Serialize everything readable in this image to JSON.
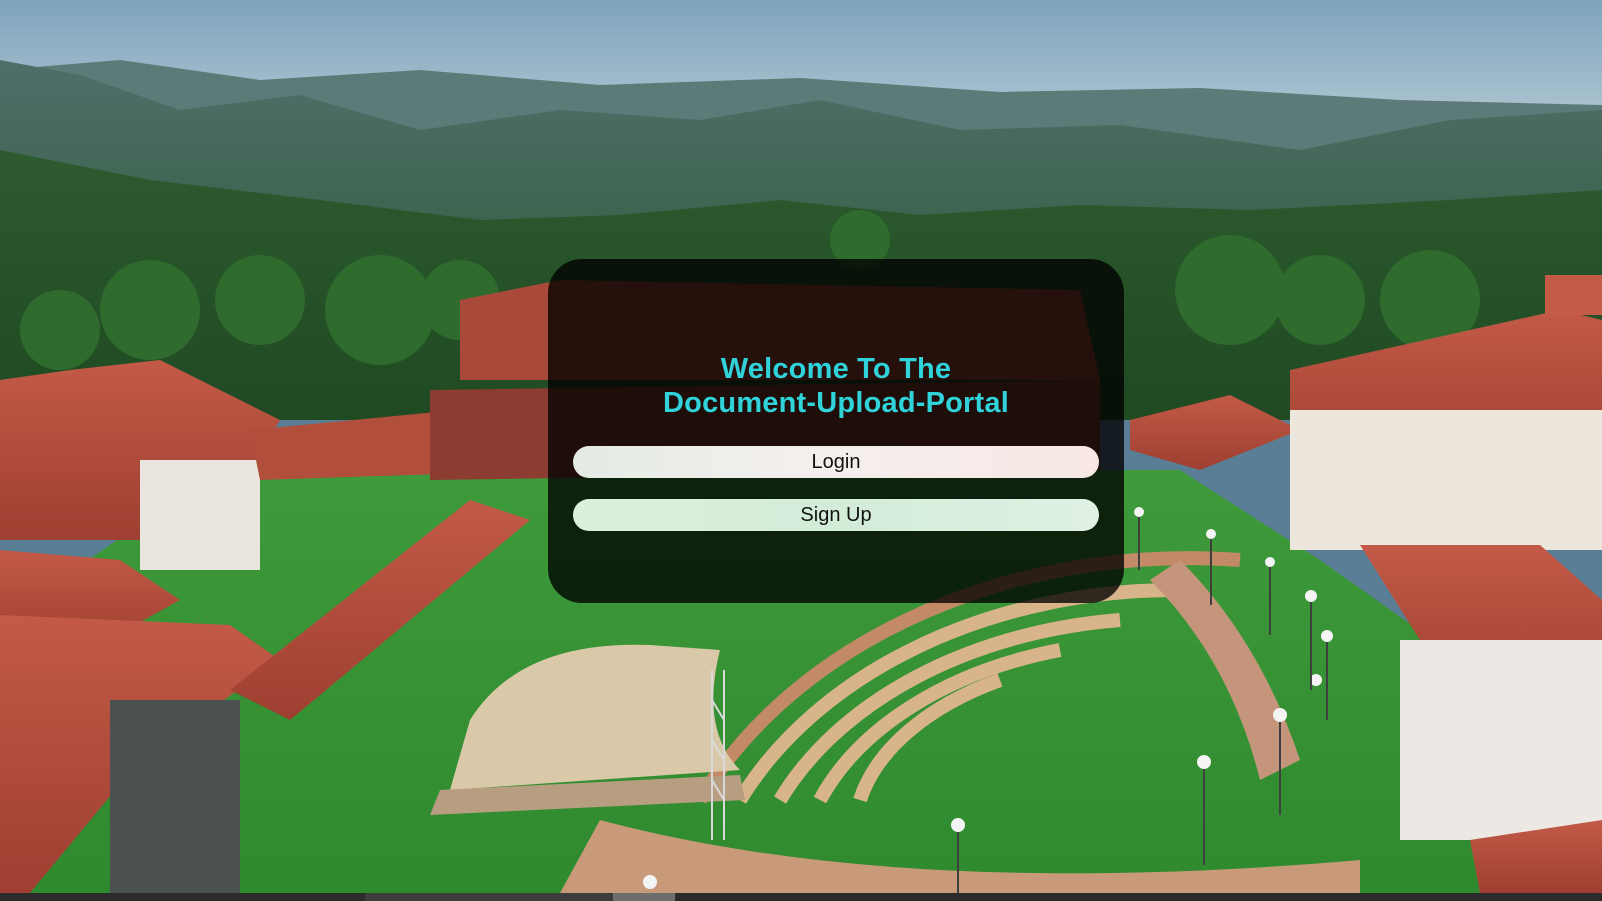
{
  "card": {
    "title_line1": "Welcome To The",
    "title_line2": "Document-Upload-Portal",
    "login_label": "Login",
    "signup_label": "Sign Up"
  },
  "colors": {
    "title": "#2fd3d9",
    "card_background": "rgba(0,0,0,0.78)"
  }
}
